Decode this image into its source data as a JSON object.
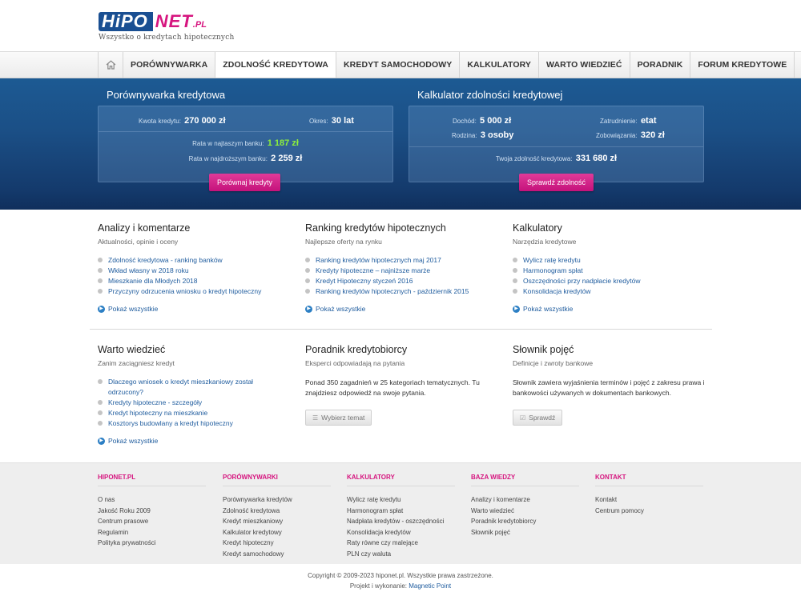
{
  "brand": {
    "logo_part1": "HiPO",
    "logo_part2": "NET",
    "logo_part3": ".PL",
    "tagline": "Wszystko o kredytach hipotecznych"
  },
  "nav": {
    "home_icon": "home-icon",
    "items": [
      "PORÓWNYWARKA",
      "ZDOLNOŚĆ KREDYTOWA",
      "KREDYT SAMOCHODOWY",
      "KALKULATORY",
      "WARTO WIEDZIEĆ",
      "PORADNIK",
      "FORUM KREDYTOWE"
    ]
  },
  "compare": {
    "title": "Porównywarka kredytowa",
    "amount_label": "Kwota kredytu:",
    "amount_value": "270 000 zł",
    "period_label": "Okres:",
    "period_value": "30 lat",
    "cheapest_label": "Rata w najtaszym banku:",
    "cheapest_value": "1 187 zł",
    "expensive_label": "Rata w najdroższym banku:",
    "expensive_value": "2 259 zł",
    "button": "Porównaj kredyty"
  },
  "capacity": {
    "title": "Kalkulator zdolności kredytowej",
    "income_label": "Dochód:",
    "income_value": "5 000 zł",
    "employment_label": "Zatrudnienie:",
    "employment_value": "etat",
    "family_label": "Rodzina:",
    "family_value": "3 osoby",
    "obligations_label": "Zobowiązania:",
    "obligations_value": "320 zł",
    "result_label": "Twoja zdolność kredytowa:",
    "result_value": "331 680 zł",
    "button": "Sprawdź zdolność"
  },
  "sections": {
    "analyses": {
      "title": "Analizy i komentarze",
      "subtitle": "Aktualności, opinie i oceny",
      "items": [
        "Zdolność kredytowa - ranking banków",
        "Wkład własny w 2018 roku",
        "Mieszkanie dla Młodych 2018",
        "Przyczyny odrzucenia wniosku o kredyt hipoteczny"
      ],
      "show_all": "Pokaż wszystkie"
    },
    "ranking": {
      "title": "Ranking kredytów hipotecznych",
      "subtitle": "Najlepsze oferty na rynku",
      "items": [
        "Ranking kredytów hipotecznych maj 2017",
        "Kredyty hipoteczne – najniższe marże",
        "Kredyt Hipoteczny styczeń 2016",
        "Ranking kredytów hipotecznych - październik 2015"
      ],
      "show_all": "Pokaż wszystkie"
    },
    "calculators": {
      "title": "Kalkulatory",
      "subtitle": "Narzędzia kredytowe",
      "items": [
        "Wylicz ratę kredytu",
        "Harmonogram spłat",
        "Oszczędności przy nadpłacie kredytów",
        "Konsolidacja kredytów"
      ],
      "show_all": "Pokaż wszystkie"
    },
    "worth": {
      "title": "Warto wiedzieć",
      "subtitle": "Zanim zaciągniesz kredyt",
      "items": [
        "Dlaczego wniosek o kredyt mieszkaniowy został odrzucony?",
        "Kredyty hipoteczne - szczegóły",
        "Kredyt hipoteczny na mieszkanie",
        "Kosztorys budowlany a kredyt hipoteczny"
      ],
      "show_all": "Pokaż wszystkie"
    },
    "guide": {
      "title": "Poradnik kredytobiorcy",
      "subtitle": "Eksperci odpowiadają na pytania",
      "text": "Ponad 350 zagadnień w 25 kategoriach tematycznych. Tu znajdziesz odpowiedź na swoje pytania.",
      "button": "Wybierz temat"
    },
    "glossary": {
      "title": "Słownik pojęć",
      "subtitle": "Definicje i zwroty bankowe",
      "text": "Słownik zawiera wyjaśnienia terminów i pojęć z zakresu prawa i bankowości używanych w dokumentach bankowych.",
      "button": "Sprawdź"
    }
  },
  "footer": {
    "columns": [
      {
        "title": "HIPONET.PL",
        "items": [
          "O nas",
          "Jakość Roku 2009",
          "Centrum prasowe",
          "Regulamin",
          "Polityka prywatności"
        ]
      },
      {
        "title": "PORÓWNYWARKI",
        "items": [
          "Porównywarka kredytów",
          "Zdolność kredytowa",
          "Kredyt mieszkaniowy",
          "Kalkulator kredytowy",
          "Kredyt hipoteczny",
          "Kredyt samochodowy"
        ]
      },
      {
        "title": "KALKULATORY",
        "items": [
          "Wylicz ratę kredytu",
          "Harmonogram spłat",
          "Nadpłata kredytów - oszczędności",
          "Konsolidacja kredytów",
          "Raty równe czy malejące",
          "PLN czy waluta"
        ]
      },
      {
        "title": "BAZA WIEDZY",
        "items": [
          "Analizy i komentarze",
          "Warto wiedzieć",
          "Poradnik kredytobiorcy",
          "Słownik pojęć"
        ]
      },
      {
        "title": "KONTAKT",
        "items": [
          "Kontakt",
          "Centrum pomocy"
        ]
      }
    ],
    "copyright": "Copyright © 2009-2023 hiponet.pl. Wszystkie prawa zastrzeżone.",
    "credit_label": "Projekt i wykonanie:",
    "credit_link": "Magnetic Point"
  },
  "colors": {
    "brand_blue": "#1a4f92",
    "brand_pink": "#d6157f",
    "link": "#1f5c9e",
    "highlight_green": "#8df03b"
  }
}
